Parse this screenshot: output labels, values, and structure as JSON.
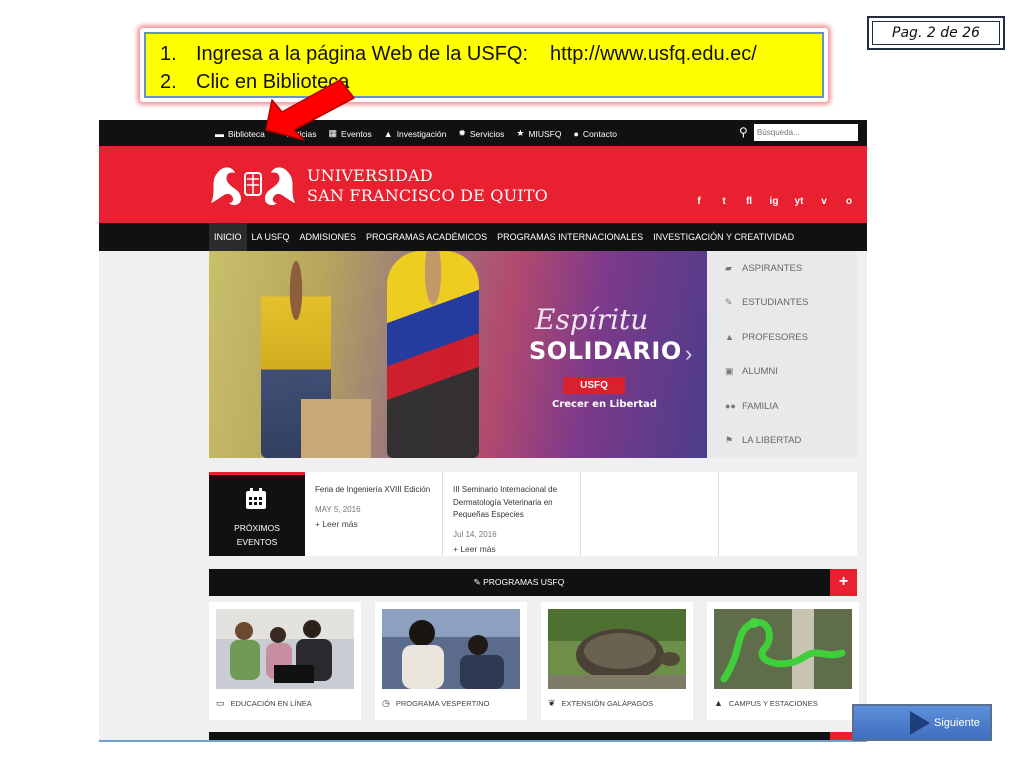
{
  "page_indicator": "Pag. 2 de 26",
  "instructions": {
    "step1_num": "1.",
    "step1_text": "Ingresa a la página Web de la USFQ:",
    "step1_url": "http://www.usfq.edu.ec/",
    "step2_num": "2.",
    "step2_text": "Clic en Biblioteca"
  },
  "colors": {
    "brand_red": "#e8202f",
    "nav_black": "#111111",
    "highlight_yellow": "#ffff00",
    "arrow_red": "#ff0000"
  },
  "site": {
    "topnav": [
      {
        "label": "Biblioteca",
        "icon": "book-icon"
      },
      {
        "label": "Noticias",
        "icon": "rss-icon"
      },
      {
        "label": "Eventos",
        "icon": "calendar-icon"
      },
      {
        "label": "Investigación",
        "icon": "flask-icon"
      },
      {
        "label": "Servicios",
        "icon": "gear-icon"
      },
      {
        "label": "MIUSFQ",
        "icon": "star-icon"
      },
      {
        "label": "Contacto",
        "icon": "chat-icon"
      }
    ],
    "search_placeholder": "Búsqueda...",
    "logo_line1": "UNIVERSIDAD",
    "logo_line2": "SAN FRANCISCO DE QUITO",
    "social": [
      "f",
      "t",
      "fl",
      "ig",
      "yt",
      "v",
      "o"
    ],
    "mainnav": [
      "INICIO",
      "LA USFQ",
      "ADMISIONES",
      "PROGRAMAS ACADÉMICOS",
      "PROGRAMAS INTERNACIONALES",
      "INVESTIGACIÓN Y CREATIVIDAD"
    ],
    "hero": {
      "title_script": "Espíritu",
      "title_bold": "SOLIDARIO",
      "badge": "USFQ",
      "tagline": "Crecer en Libertad"
    },
    "sidemenu": [
      {
        "label": "ASPIRANTES",
        "icon": "folder-icon"
      },
      {
        "label": "ESTUDIANTES",
        "icon": "pencil-icon"
      },
      {
        "label": "PROFESORES",
        "icon": "flask-icon"
      },
      {
        "label": "ALUMNI",
        "icon": "briefcase-icon"
      },
      {
        "label": "FAMILIA",
        "icon": "users-icon"
      },
      {
        "label": "LA LIBERTAD",
        "icon": "flag-icon"
      }
    ],
    "events": {
      "header_line1": "PRÓXIMOS",
      "header_line2": "EVENTOS",
      "items": [
        {
          "title": "Feria de Ingeniería XVIII Edición",
          "date": "MAY 5, 2016",
          "more": "+ Leer más"
        },
        {
          "title": "III Seminario Internacional de Dermatología Veterinaria en Pequeñas Especies",
          "date": "Jul 14, 2016",
          "more": "+ Leer más"
        }
      ]
    },
    "programs_label": "PROGRAMAS USFQ",
    "programs_plus": "+",
    "cards": [
      {
        "label": "EDUCACIÓN EN LÍNEA",
        "icon": "monitor-icon"
      },
      {
        "label": "PROGRAMA VESPERTINO",
        "icon": "clock-icon"
      },
      {
        "label": "EXTENSIÓN GALÁPAGOS",
        "icon": "leaf-icon"
      },
      {
        "label": "CAMPUS Y ESTACIONES",
        "icon": "flask-icon"
      }
    ]
  },
  "next_button": "Siguiente"
}
